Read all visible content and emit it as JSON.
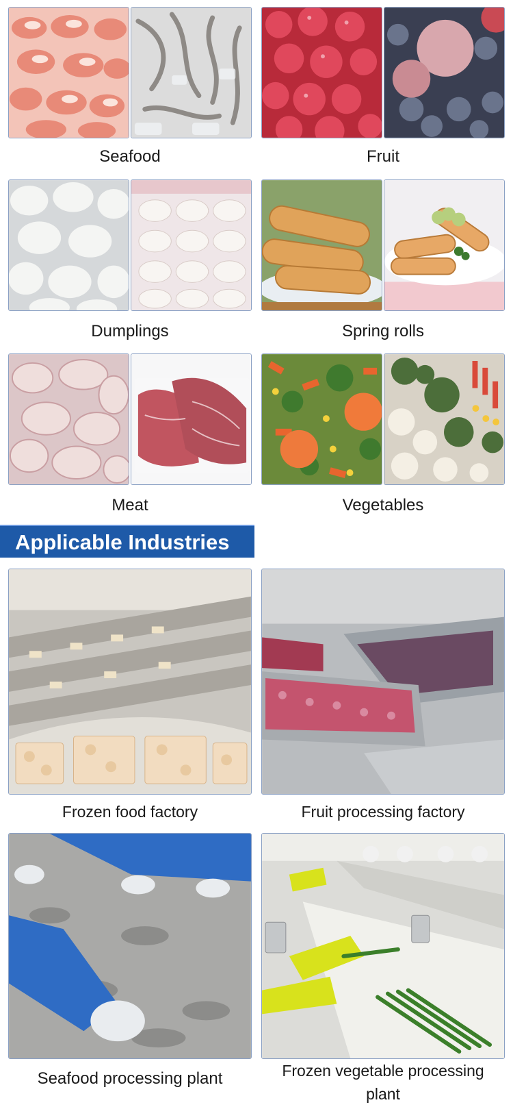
{
  "categories": [
    {
      "label": "Seafood",
      "images": [
        "shrimp",
        "octopus"
      ]
    },
    {
      "label": "Fruit",
      "images": [
        "strawberries",
        "blueberries-plums"
      ]
    },
    {
      "label": "Dumplings",
      "images": [
        "dumplings",
        "packaged-dumplings"
      ]
    },
    {
      "label": "Spring rolls",
      "images": [
        "spring-rolls",
        "spring-rolls-plate"
      ]
    },
    {
      "label": "Meat",
      "images": [
        "chicken-wings",
        "packaged-steak"
      ]
    },
    {
      "label": "Vegetables",
      "images": [
        "mixed-vegetables",
        "broccoli-cauliflower-mix"
      ]
    }
  ],
  "section_title": "Applicable Industries",
  "industries": [
    {
      "label": "Frozen food factory",
      "image": "frozen-food-conveyor"
    },
    {
      "label": "Fruit processing factory",
      "image": "fruit-processing-line"
    },
    {
      "label": "Seafood processing plant",
      "image": "seafood-sorting-hands"
    },
    {
      "label": "Frozen vegetable processing plant",
      "image": "asparagus-processing-line"
    }
  ],
  "colors": {
    "banner": "#1e5aa8",
    "image_border": "#8aa0c4"
  }
}
